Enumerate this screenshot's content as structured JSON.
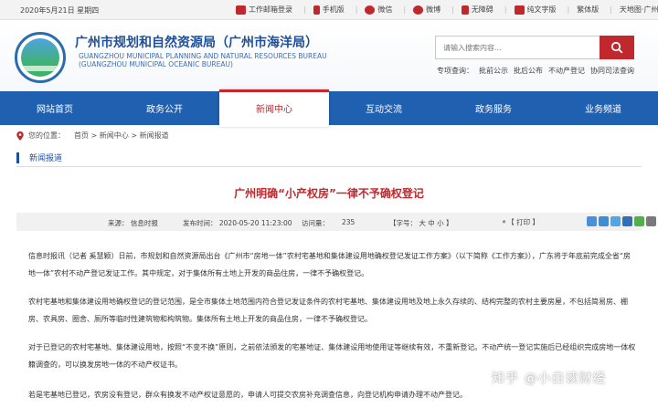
{
  "topbar": {
    "date": "2020年5月21日 星期四",
    "links": [
      {
        "label": "工作邮箱登录",
        "icon": "mail-icon",
        "color": "#c0282d"
      },
      {
        "label": "手机版",
        "icon": "mobile-icon",
        "color": "#c0282d"
      },
      {
        "label": "微信",
        "icon": "wechat-icon",
        "color": "#c0282d"
      },
      {
        "label": "微博",
        "icon": "weibo-icon",
        "color": "#c0282d"
      },
      {
        "label": "无障碍",
        "icon": "accessibility-icon",
        "color": "#c0282d"
      },
      {
        "label": "纯文字版",
        "icon": "text-icon",
        "color": "#c0282d"
      },
      {
        "label": "繁体版",
        "icon": "",
        "color": ""
      },
      {
        "label": "天地图·广州",
        "icon": "",
        "color": ""
      }
    ]
  },
  "header": {
    "title": "广州市规划和自然资源局（广州市海洋局）",
    "en_line1": "GUANGZHOU MUNICIPAL PLANNING AND NATURAL RESOURCES BUREAU",
    "en_line2": "(GUANGZHOU MUNICIPAL OCEANIC BUREAU)",
    "search_placeholder": "请输入搜索内容...",
    "quick_label": "专项查询：",
    "quick_links": [
      "批前公示",
      "批后公布",
      "不动产登记",
      "协同司法查询"
    ]
  },
  "nav": {
    "items": [
      "网站首页",
      "政务公开",
      "新闻中心",
      "互动交流",
      "政务服务",
      "业务频道"
    ],
    "active_index": 2
  },
  "breadcrumb": {
    "prefix": "您的位置：",
    "path": "首页 > 新闻中心 > 新闻报道"
  },
  "section": {
    "label": "新闻报道"
  },
  "article": {
    "title": "广州明确“小产权房”一律不予确权登记",
    "meta": {
      "source": "来源：  信息时报",
      "publish": "发布时间：  2020-05-20 11:23:00",
      "views": "访问量：",
      "views_count": "235",
      "font_size": "【字号：  大  中  小  】",
      "print": "【  打印  】"
    },
    "paragraphs": [
      "信息时报讯（记者 奚慧颖）日前，市规划和自然资源局出台《广州市“房地一体”农村宅基地和集体建设用地确权登记发证工作方案》（以下简称《工作方案》），广东将于年底前完成全省“房地一体”农村不动产登记发证工作。其中规定，对于集体所有土地上开发的商品住房，一律不予确权登记。",
      "农村宅基地和集体建设用地确权登记的登记范围，是全市集体土地范围内符合登记发证条件的农村宅基地、集体建设用地及地上永久存续的、结构完整的农村主要房屋，不包括简易房、棚房、农具房、圈舍、厕所等临时性建筑物和构筑物。集体所有土地上开发的商品住房，一律不予确权登记。",
      "对于已登记的农村宅基地、集体建设用地，按照“不变不换”原则，之前依法颁发的宅基地证、集体建设用地使用证等继续有效，不重新登记。不动产统一登记实施后已经组织完成房地一体权籍调查的，可以换发房地一体的不动产权证书。",
      "若是宅基地已登记，农房没有登记，群众有换发不动产权证意愿的，申请人可提交农房补充调查信息，向登记机构申请办理不动产登记。"
    ]
  },
  "share_icons": [
    {
      "name": "share-qzone-icon",
      "color": "#4a90d9"
    },
    {
      "name": "share-weibo-icon",
      "color": "#3b8ed6"
    },
    {
      "name": "share-tqq-icon",
      "color": "#55a5e0"
    },
    {
      "name": "share-renren-icon",
      "color": "#2e6fb8"
    },
    {
      "name": "share-wechat-icon",
      "color": "#52b04a"
    },
    {
      "name": "share-more-icon",
      "color": "#7a7a7a"
    }
  ],
  "watermark": "知乎 @小白读财经",
  "colors": {
    "brand_blue": "#2060b0",
    "accent_red": "#c0282d"
  }
}
